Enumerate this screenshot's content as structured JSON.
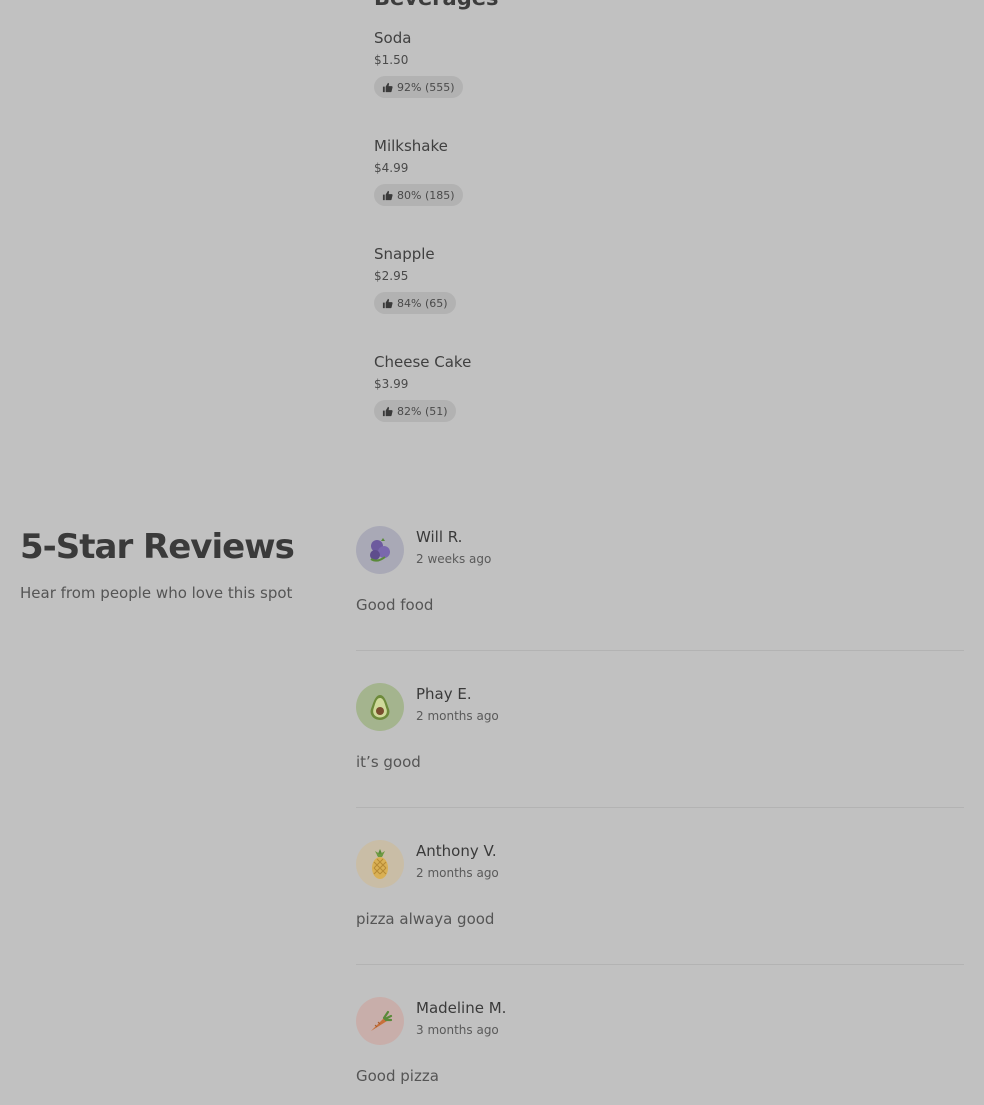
{
  "menu": {
    "section_title": "Beverages",
    "items": [
      {
        "name": "Soda",
        "price": "$1.50",
        "rating": "92% (555)"
      },
      {
        "name": "Milkshake",
        "price": "$4.99",
        "rating": "80% (185)"
      },
      {
        "name": "Snapple",
        "price": "$2.95",
        "rating": "84% (65)"
      },
      {
        "name": "Cheese Cake",
        "price": "$3.99",
        "rating": "82% (51)"
      }
    ]
  },
  "reviews": {
    "title": "5-Star Reviews",
    "subtitle": "Hear from people who love this spot",
    "items": [
      {
        "author": "Will R.",
        "date": "2 weeks ago",
        "text": "Good food",
        "avatar_icon": "blueberry-icon",
        "avatar_bg": "#a9a9b6"
      },
      {
        "author": "Phay E.",
        "date": "2 months ago",
        "text": "it’s good",
        "avatar_icon": "avocado-icon",
        "avatar_bg": "#a4b48e"
      },
      {
        "author": "Anthony V.",
        "date": "2 months ago",
        "text": "pizza alwaya good",
        "avatar_icon": "pineapple-icon",
        "avatar_bg": "#c9bda6"
      },
      {
        "author": "Madeline M.",
        "date": "3 months ago",
        "text": "Good pizza",
        "avatar_icon": "carrot-icon",
        "avatar_bg": "#c8aeaa"
      }
    ]
  }
}
